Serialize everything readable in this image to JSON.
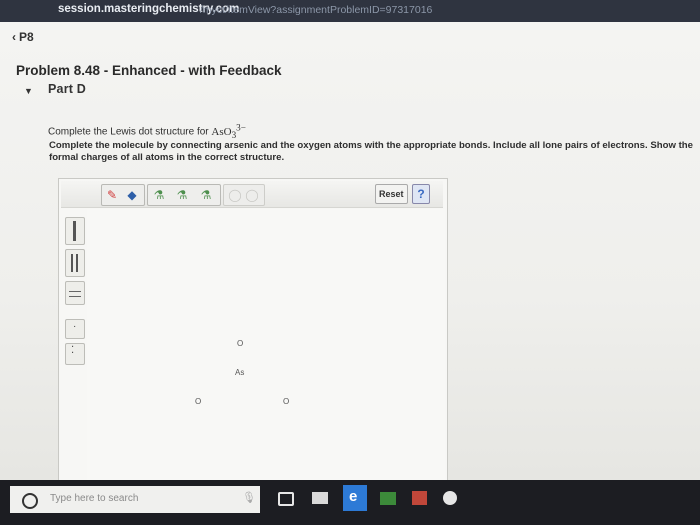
{
  "browser": {
    "url_host": "session.masteringchemistry.com",
    "url_path": "/myct/itemView?assignmentProblemID=97317016"
  },
  "nav": {
    "back_label": "P8"
  },
  "problem": {
    "title": "Problem 8.48 - Enhanced - with Feedback",
    "part_label": "Part D",
    "question_prefix": "Complete the Lewis dot structure for ",
    "formula_base": "AsO",
    "formula_sub": "3",
    "formula_sup": "3−",
    "instruction": "Complete the molecule by connecting arsenic and the oxygen atoms with the appropriate bonds. Include all lone pairs of electrons. Show the formal charges of all atoms in the correct structure."
  },
  "editor": {
    "reset_label": "Reset",
    "help_label": "?",
    "atoms": [
      {
        "symbol": "O"
      },
      {
        "symbol": "As"
      },
      {
        "symbol": "O"
      },
      {
        "symbol": "O"
      }
    ]
  },
  "taskbar": {
    "search_placeholder": "Type here to search"
  },
  "colors": {
    "taskbar": "#1c1d22",
    "accent_blue": "#3a6ac2",
    "store_green": "#3c8a3a",
    "edge_blue": "#2d7ad6"
  }
}
